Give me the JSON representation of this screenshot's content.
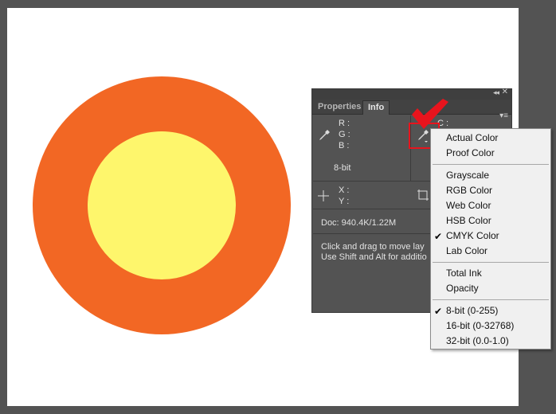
{
  "panel": {
    "tabs": [
      "Properties",
      "Info"
    ],
    "colors": {
      "outer_circle": "#f26724",
      "inner_circle": "#fef66c",
      "highlight": "#e8141d"
    },
    "readout": {
      "r_label": "R :",
      "g_label": "G :",
      "b_label": "B :",
      "c_label": "C :",
      "bit_depth": "8-bit",
      "x_label": "X :",
      "y_label": "Y :"
    },
    "doc_size": "Doc: 940.4K/1.22M",
    "hint_line1": "Click and drag to move lay",
    "hint_line2": "Use Shift and Alt for additio"
  },
  "menu": {
    "actual_color": "Actual Color",
    "proof_color": "Proof Color",
    "grayscale": "Grayscale",
    "rgb_color": "RGB Color",
    "web_color": "Web Color",
    "hsb_color": "HSB Color",
    "cmyk_color": "CMYK Color",
    "lab_color": "Lab Color",
    "total_ink": "Total Ink",
    "opacity": "Opacity",
    "bit8": "8-bit (0-255)",
    "bit16": "16-bit (0-32768)",
    "bit32": "32-bit (0.0-1.0)",
    "checkmark": "✔"
  }
}
